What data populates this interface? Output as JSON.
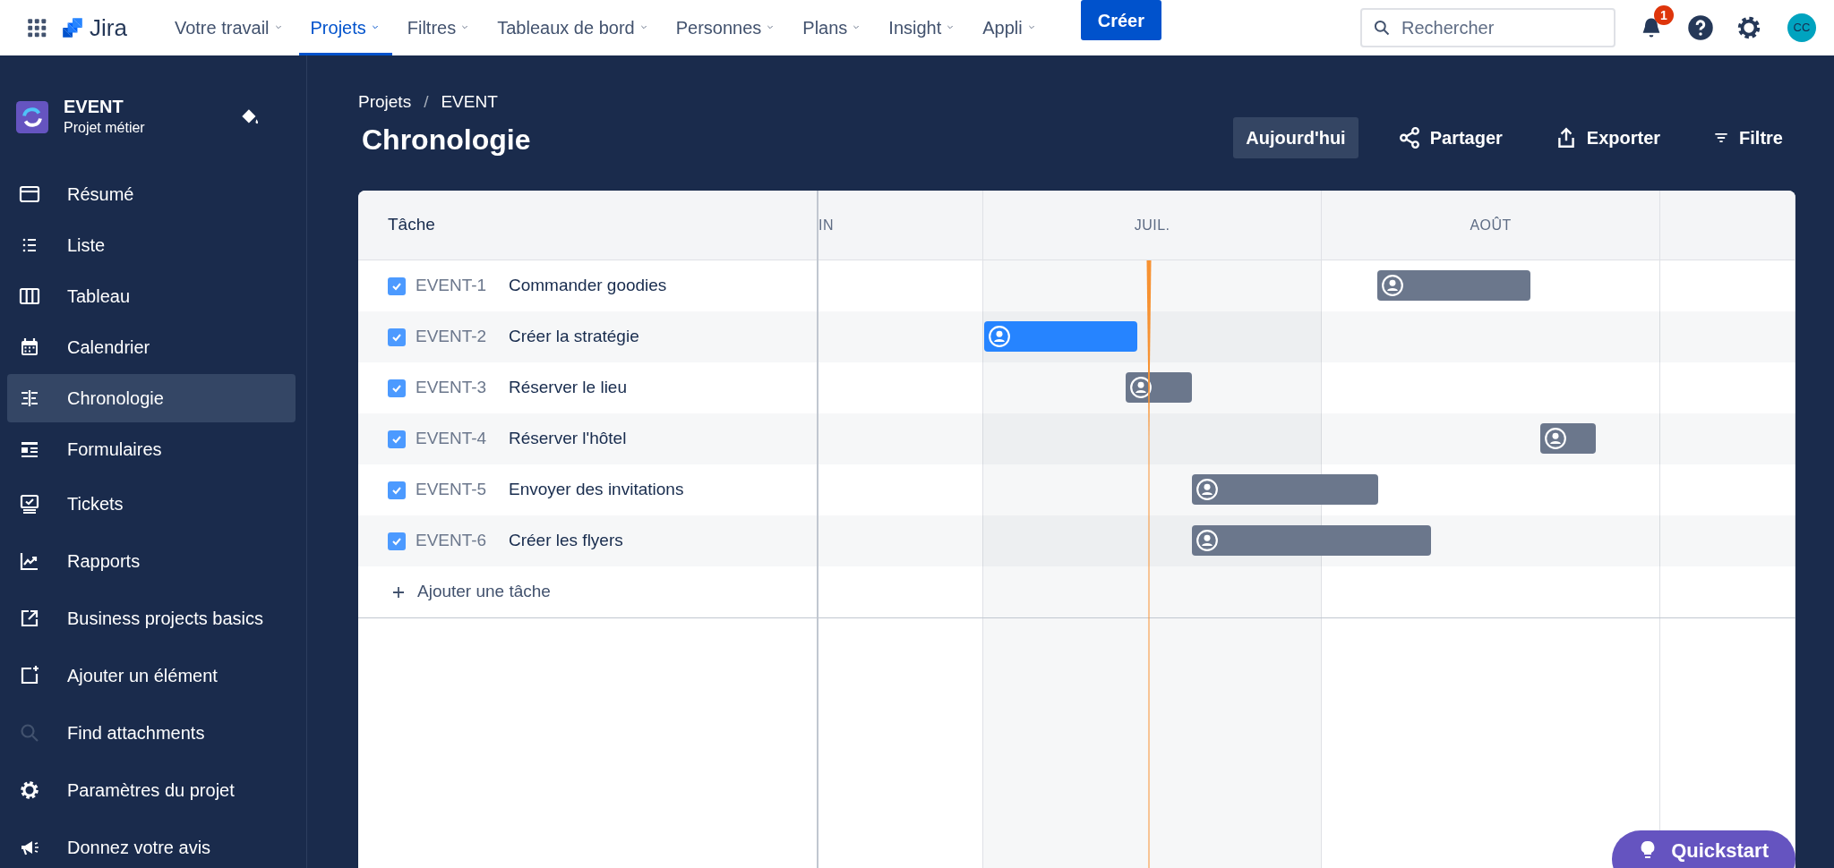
{
  "top_nav": {
    "app_name": "Jira",
    "menus": [
      {
        "label": "Votre travail",
        "selected": false
      },
      {
        "label": "Projets",
        "selected": true
      },
      {
        "label": "Filtres",
        "selected": false
      },
      {
        "label": "Tableaux de bord",
        "selected": false
      },
      {
        "label": "Personnes",
        "selected": false
      },
      {
        "label": "Plans",
        "selected": false
      },
      {
        "label": "Insight",
        "selected": false
      },
      {
        "label": "Appli",
        "selected": false
      }
    ],
    "create_button": "Créer",
    "search": {
      "placeholder": "Rechercher"
    },
    "notification_count": "1",
    "avatar_initials": "CC"
  },
  "sidebar": {
    "project_name": "EVENT",
    "project_type": "Projet métier",
    "items": [
      {
        "label": "Résumé",
        "selected": false
      },
      {
        "label": "Liste",
        "selected": false
      },
      {
        "label": "Tableau",
        "selected": false
      },
      {
        "label": "Calendrier",
        "selected": false
      },
      {
        "label": "Chronologie",
        "selected": true
      },
      {
        "label": "Formulaires",
        "selected": false
      },
      {
        "label": "Tickets",
        "selected": false
      },
      {
        "label": "Rapports",
        "selected": false
      },
      {
        "label": "Business projects basics",
        "selected": false
      },
      {
        "label": "Ajouter un élément",
        "selected": false
      },
      {
        "label": "Find attachments",
        "selected": false
      },
      {
        "label": "Paramètres du projet",
        "selected": false
      },
      {
        "label": "Donnez votre avis",
        "selected": false
      }
    ]
  },
  "breadcrumbs": {
    "items": [
      "Projets",
      "EVENT"
    ],
    "separator": "/"
  },
  "page_title": "Chronologie",
  "actions": [
    "Aujourd'hui",
    "Partager",
    "Exporter",
    "Filtre"
  ],
  "timeline": {
    "task_column_header": "Tâche",
    "months": [
      "IN",
      "JUIL.",
      "AOÛT"
    ],
    "tasks": [
      {
        "key": "EVENT-1",
        "summary": "Commander goodies",
        "checked": true,
        "selected": false
      },
      {
        "key": "EVENT-2",
        "summary": "Créer la stratégie",
        "checked": true,
        "selected": true
      },
      {
        "key": "EVENT-3",
        "summary": "Réserver le lieu",
        "checked": true,
        "selected": false
      },
      {
        "key": "EVENT-4",
        "summary": "Réserver l'hôtel",
        "checked": true,
        "selected": false
      },
      {
        "key": "EVENT-5",
        "summary": "Envoyer des invitations",
        "checked": true,
        "selected": false
      },
      {
        "key": "EVENT-6",
        "summary": "Créer les flyers",
        "checked": true,
        "selected": false
      }
    ],
    "add_task": "Ajouter une tâche"
  },
  "quickstart": "Quickstart"
}
